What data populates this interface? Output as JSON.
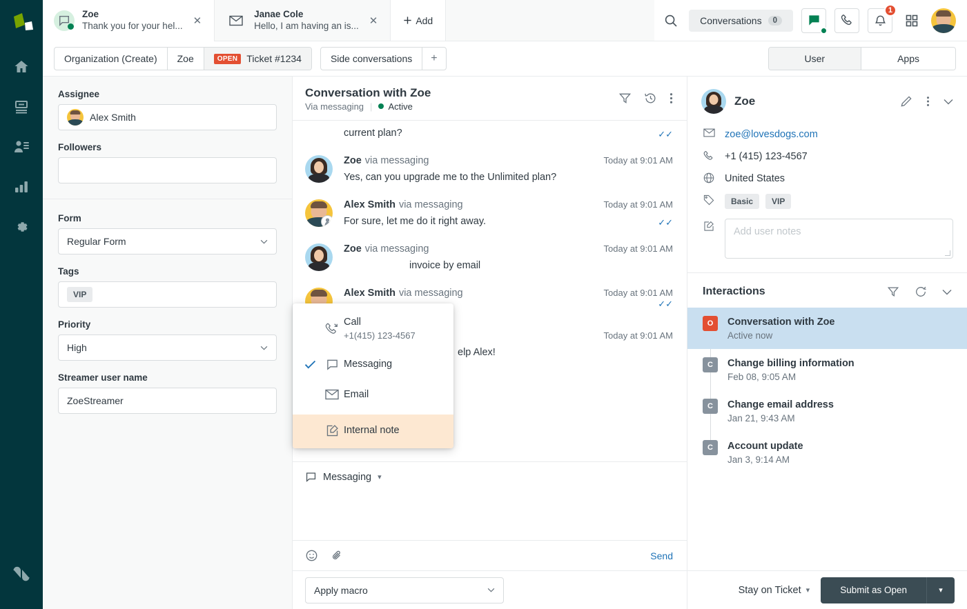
{
  "rail": {
    "logo_name": "zendesk-logo",
    "items": [
      {
        "name": "home",
        "label": "Home"
      },
      {
        "name": "views",
        "label": "Views"
      },
      {
        "name": "customers",
        "label": "Customers"
      },
      {
        "name": "reporting",
        "label": "Reporting"
      },
      {
        "name": "settings",
        "label": "Settings"
      }
    ],
    "bottom_logo": "zendesk-z-mark"
  },
  "topbar": {
    "tabs": [
      {
        "title": "Zoe",
        "subtitle": "Thank you for your hel...",
        "icon": "messaging-icon",
        "active": true,
        "online": true
      },
      {
        "title": "Janae Cole",
        "subtitle": "Hello, I am having an is...",
        "icon": "email-icon",
        "active": false,
        "online": false
      }
    ],
    "add_label": "Add",
    "search_icon": "search-icon",
    "conversations_label": "Conversations",
    "conversations_count": "0",
    "chat_icon": "chat-icon",
    "phone_icon": "phone-icon",
    "bell_icon": "bell-icon",
    "bell_badge": "1",
    "apps_grid_icon": "apps-grid-icon",
    "avatar_name": "Alex Smith"
  },
  "breadcrumbs": {
    "organization": "Organization (Create)",
    "user": "Zoe",
    "status_badge": "OPEN",
    "ticket": "Ticket #1234",
    "side_conversations": "Side conversations",
    "toggle": {
      "user": "User",
      "apps": "Apps",
      "active": "User"
    }
  },
  "fields": {
    "assignee": {
      "label": "Assignee",
      "value": "Alex Smith"
    },
    "followers": {
      "label": "Followers",
      "value": ""
    },
    "form": {
      "label": "Form",
      "value": "Regular Form"
    },
    "tags": {
      "label": "Tags",
      "values": [
        "VIP"
      ]
    },
    "priority": {
      "label": "Priority",
      "value": "High"
    },
    "streamer": {
      "label": "Streamer user name",
      "value": "ZoeStreamer"
    }
  },
  "conversation": {
    "title": "Conversation with Zoe",
    "via": "Via messaging",
    "status": "Active",
    "actions": [
      "filter-icon",
      "history-icon",
      "more-options-icon"
    ],
    "messages": [
      {
        "partial_top": true,
        "text": "current plan?",
        "read": true
      },
      {
        "author": "Zoe",
        "via": "via messaging",
        "time": "Today at 9:01 AM",
        "text": "Yes, can you upgrade me to the Unlimited plan?",
        "agent": false,
        "read": false
      },
      {
        "author": "Alex Smith",
        "via": "via messaging",
        "time": "Today at 9:01 AM",
        "text": "For sure, let me do it right away.",
        "agent": true,
        "read": true
      },
      {
        "author": "Zoe",
        "via": "via messaging",
        "time": "Today at 9:01 AM",
        "text": "invoice by email",
        "agent": false,
        "read": false,
        "occluded": true
      },
      {
        "author": "Alex Smith",
        "via": "via messaging",
        "time": "Today at 9:01 AM",
        "text": "",
        "agent": true,
        "read": true,
        "occluded": true
      },
      {
        "author": "Zoe",
        "via": "via messaging",
        "time": "Today at 9:01 AM",
        "text": "elp Alex!",
        "agent": false,
        "read": false,
        "occluded": true
      }
    ]
  },
  "channel_dropdown": {
    "items": [
      {
        "label": "Call",
        "sublabel": "+1(415) 123-4567",
        "icon": "call-icon",
        "checked": false,
        "highlighted": false
      },
      {
        "label": "Messaging",
        "sublabel": "",
        "icon": "messaging-icon",
        "checked": true,
        "highlighted": false
      },
      {
        "label": "Email",
        "sublabel": "",
        "icon": "email-icon",
        "checked": false,
        "highlighted": false
      },
      {
        "label": "Internal note",
        "sublabel": "",
        "icon": "internal-note-icon",
        "checked": false,
        "highlighted": true
      }
    ]
  },
  "composer": {
    "channel": "Messaging",
    "emoji_icon": "emoji-icon",
    "attachment_icon": "attachment-icon",
    "send_label": "Send",
    "macro_placeholder": "Apply macro"
  },
  "user_panel": {
    "name": "Zoe",
    "edit_icon": "pencil-icon",
    "more_icon": "more-options-icon",
    "collapse_icon": "chevron-down-icon",
    "email": "zoe@lovesdogs.com",
    "phone": "+1 (415) 123-4567",
    "country": "United States",
    "tags": [
      "Basic",
      "VIP"
    ],
    "notes_placeholder": "Add user notes"
  },
  "interactions": {
    "title": "Interactions",
    "filter_icon": "filter-icon",
    "refresh_icon": "refresh-icon",
    "collapse_icon": "chevron-down-icon",
    "items": [
      {
        "badge": "O",
        "badge_type": "open",
        "title": "Conversation with Zoe",
        "sub": "Active now",
        "selected": true
      },
      {
        "badge": "C",
        "badge_type": "closed",
        "title": "Change billing information",
        "sub": "Feb 08, 9:05 AM",
        "selected": false
      },
      {
        "badge": "C",
        "badge_type": "closed",
        "title": "Change email address",
        "sub": "Jan 21, 9:43 AM",
        "selected": false
      },
      {
        "badge": "C",
        "badge_type": "closed",
        "title": "Account update",
        "sub": "Jan 3, 9:14 AM",
        "selected": false
      }
    ]
  },
  "submit": {
    "stay_label": "Stay on Ticket",
    "submit_label": "Submit as Open",
    "dropdown_icon": "chevron-down-icon"
  },
  "colors": {
    "rail_bg": "#03363d",
    "accent_green": "#038153",
    "accent_red": "#e34f32",
    "link_blue": "#1f73b7",
    "note_highlight": "#fde8d2",
    "selected_blue": "#c9dff0",
    "submit_dark": "#3b4c54"
  }
}
